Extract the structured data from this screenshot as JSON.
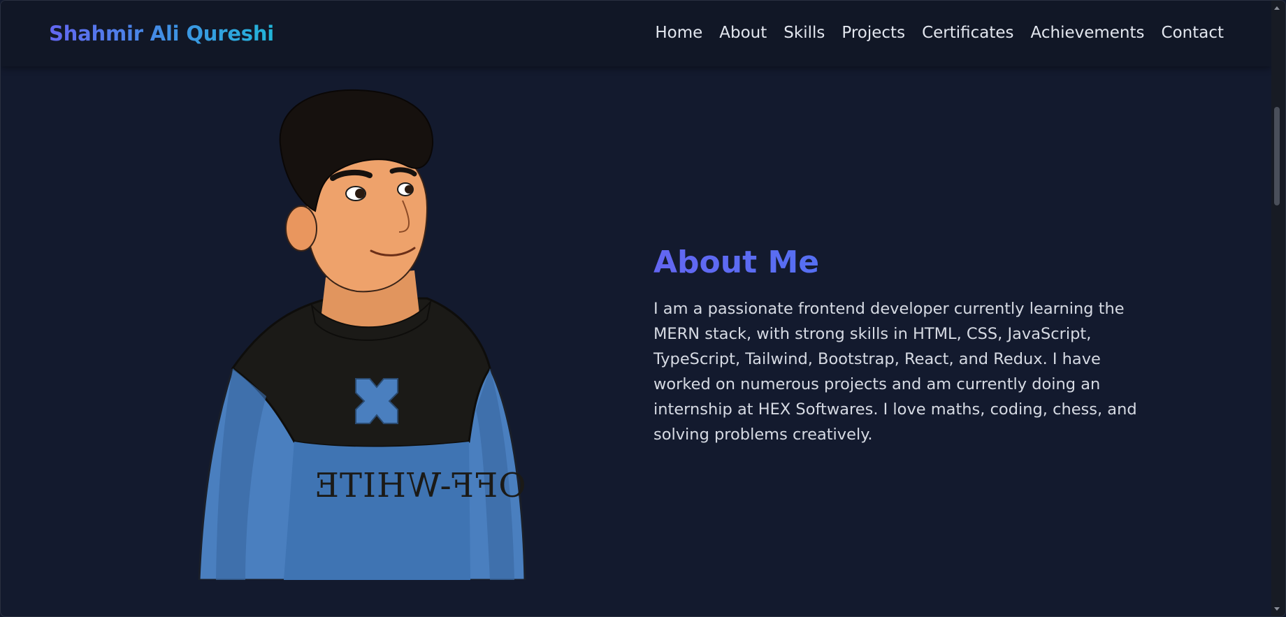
{
  "navbar": {
    "brand": "Shahmir Ali Qureshi",
    "links": [
      "Home",
      "About",
      "Skills",
      "Projects",
      "Certificates",
      "Achievements",
      "Contact"
    ]
  },
  "about": {
    "title": "About Me",
    "text": "I am a passionate frontend developer currently learning the MERN stack, with strong skills in HTML, CSS, JavaScript, TypeScript, Tailwind, Bootstrap, React, and Redux. I have worked on numerous projects and am currently doing an internship at HEX Softwares. I love maths, coding, chess, and solving problems creatively."
  },
  "avatar": {
    "shirt_text": "OFF-WHITE"
  },
  "colors": {
    "background": "#131a2e",
    "navbar": "#111726",
    "accent_start": "#6366f1",
    "accent_end": "#22b5d8",
    "text": "#d6dae3"
  }
}
